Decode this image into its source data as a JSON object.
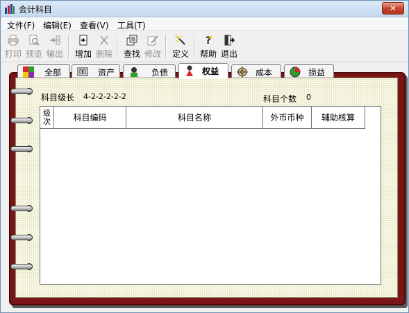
{
  "window": {
    "title": "会计科目",
    "close_label": "✕"
  },
  "menu": {
    "items": [
      "文件(F)",
      "编辑(E)",
      "查看(V)",
      "工具(T)"
    ]
  },
  "toolbar": {
    "buttons": [
      {
        "label": "打印",
        "icon": "printer-icon",
        "enabled": false
      },
      {
        "label": "预览",
        "icon": "preview-icon",
        "enabled": false
      },
      {
        "label": "输出",
        "icon": "export-icon",
        "enabled": false
      },
      {
        "label": "增加",
        "icon": "add-icon",
        "enabled": true
      },
      {
        "label": "删除",
        "icon": "delete-icon",
        "enabled": false
      },
      {
        "label": "查找",
        "icon": "find-icon",
        "enabled": true
      },
      {
        "label": "修改",
        "icon": "edit-icon",
        "enabled": false
      },
      {
        "label": "定义",
        "icon": "magic-wand-icon",
        "enabled": true
      },
      {
        "label": "帮助",
        "icon": "help-icon",
        "enabled": true
      },
      {
        "label": "退出",
        "icon": "exit-icon",
        "enabled": true
      }
    ]
  },
  "tabs": {
    "items": [
      {
        "label": "全部",
        "icon": "all-icon"
      },
      {
        "label": "资产",
        "icon": "assets-icon"
      },
      {
        "label": "负债",
        "icon": "liabilities-icon"
      },
      {
        "label": "权益",
        "icon": "equity-icon"
      },
      {
        "label": "成本",
        "icon": "cost-icon"
      },
      {
        "label": "损益",
        "icon": "profit-loss-icon"
      }
    ],
    "active": "权益"
  },
  "info": {
    "level_label": "科目级长",
    "level_value": "4-2-2-2-2-2",
    "count_label": "科目个数",
    "count_value": "0"
  },
  "table": {
    "columns": [
      "级次",
      "科目编码",
      "科目名称",
      "外币币种",
      "辅助核算"
    ],
    "rows": []
  },
  "colors": {
    "binder": "#7a1515",
    "paper": "#fafae6",
    "close_button": "#c7452b"
  }
}
